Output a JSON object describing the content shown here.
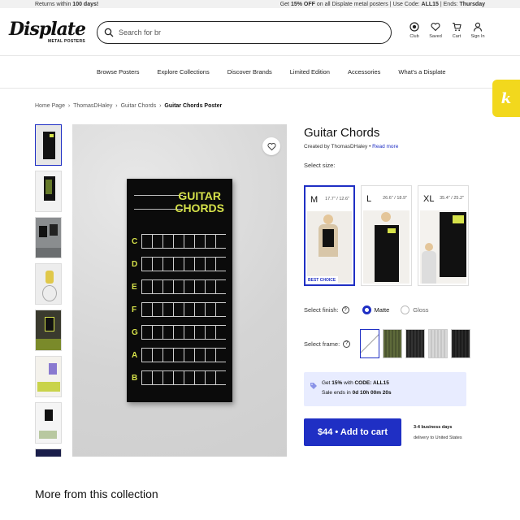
{
  "topbar": {
    "left_prefix": "Returns within ",
    "left_bold": "100 days!",
    "right_prefix": "Get ",
    "right_pct": "15% OFF",
    "right_mid": " on all Displate metal posters | Use Code: ",
    "right_code": "ALL15",
    "right_sep": " | Ends: ",
    "right_day": "Thursday"
  },
  "logo": {
    "word": "Displate",
    "sub": "METAL POSTERS"
  },
  "search": {
    "value": "Search for br"
  },
  "header_icons": [
    {
      "label": "Club",
      "icon": "club-icon"
    },
    {
      "label": "Saved",
      "icon": "heart-icon"
    },
    {
      "label": "Cart",
      "icon": "cart-icon"
    },
    {
      "label": "Sign In",
      "icon": "user-icon"
    }
  ],
  "nav": [
    "Browse Posters",
    "Explore Collections",
    "Discover Brands",
    "Limited Edition",
    "Accessories",
    "What's a Displate"
  ],
  "fab": "k",
  "breadcrumb": {
    "items": [
      "Home Page",
      "ThomasDHaley",
      "Guitar Chords"
    ],
    "current": "Guitar Chords Poster",
    "sep": "›"
  },
  "poster": {
    "title_line1": "GUITAR",
    "title_line2": "CHORDS",
    "keys": [
      "C",
      "D",
      "E",
      "F",
      "G",
      "A",
      "B"
    ]
  },
  "product": {
    "title": "Guitar Chords",
    "by_prefix": "Created by ThomasDHaley • ",
    "read_more": "Read more"
  },
  "select_size": "Select size:",
  "sizes": [
    {
      "label": "M",
      "dims": "17.7\" / 12.6\"",
      "badge": "BEST CHOICE"
    },
    {
      "label": "L",
      "dims": "26.6\" / 18.9\""
    },
    {
      "label": "XL",
      "dims": "35.4\" / 25.2\""
    }
  ],
  "finish": {
    "label": "Select finish:",
    "options": [
      "Matte",
      "Gloss"
    ],
    "selected": "Matte"
  },
  "frame": {
    "label": "Select frame:"
  },
  "promo": {
    "line1_prefix": "Get ",
    "line1_pct": "15%",
    "line1_mid": " with ",
    "line1_code": "CODE: ALL15",
    "line2_prefix": "Sale ends in ",
    "line2_time": "0d 10h 00m 20s"
  },
  "cart": {
    "label": "$44 • Add to cart"
  },
  "shipping": {
    "line1": "3-4 business days",
    "line2": "delivery to United States"
  },
  "more": "More from this collection",
  "colors": {
    "accent": "#1f2fc4",
    "fab": "#f2d81d",
    "poster_text": "#d6e24a"
  }
}
